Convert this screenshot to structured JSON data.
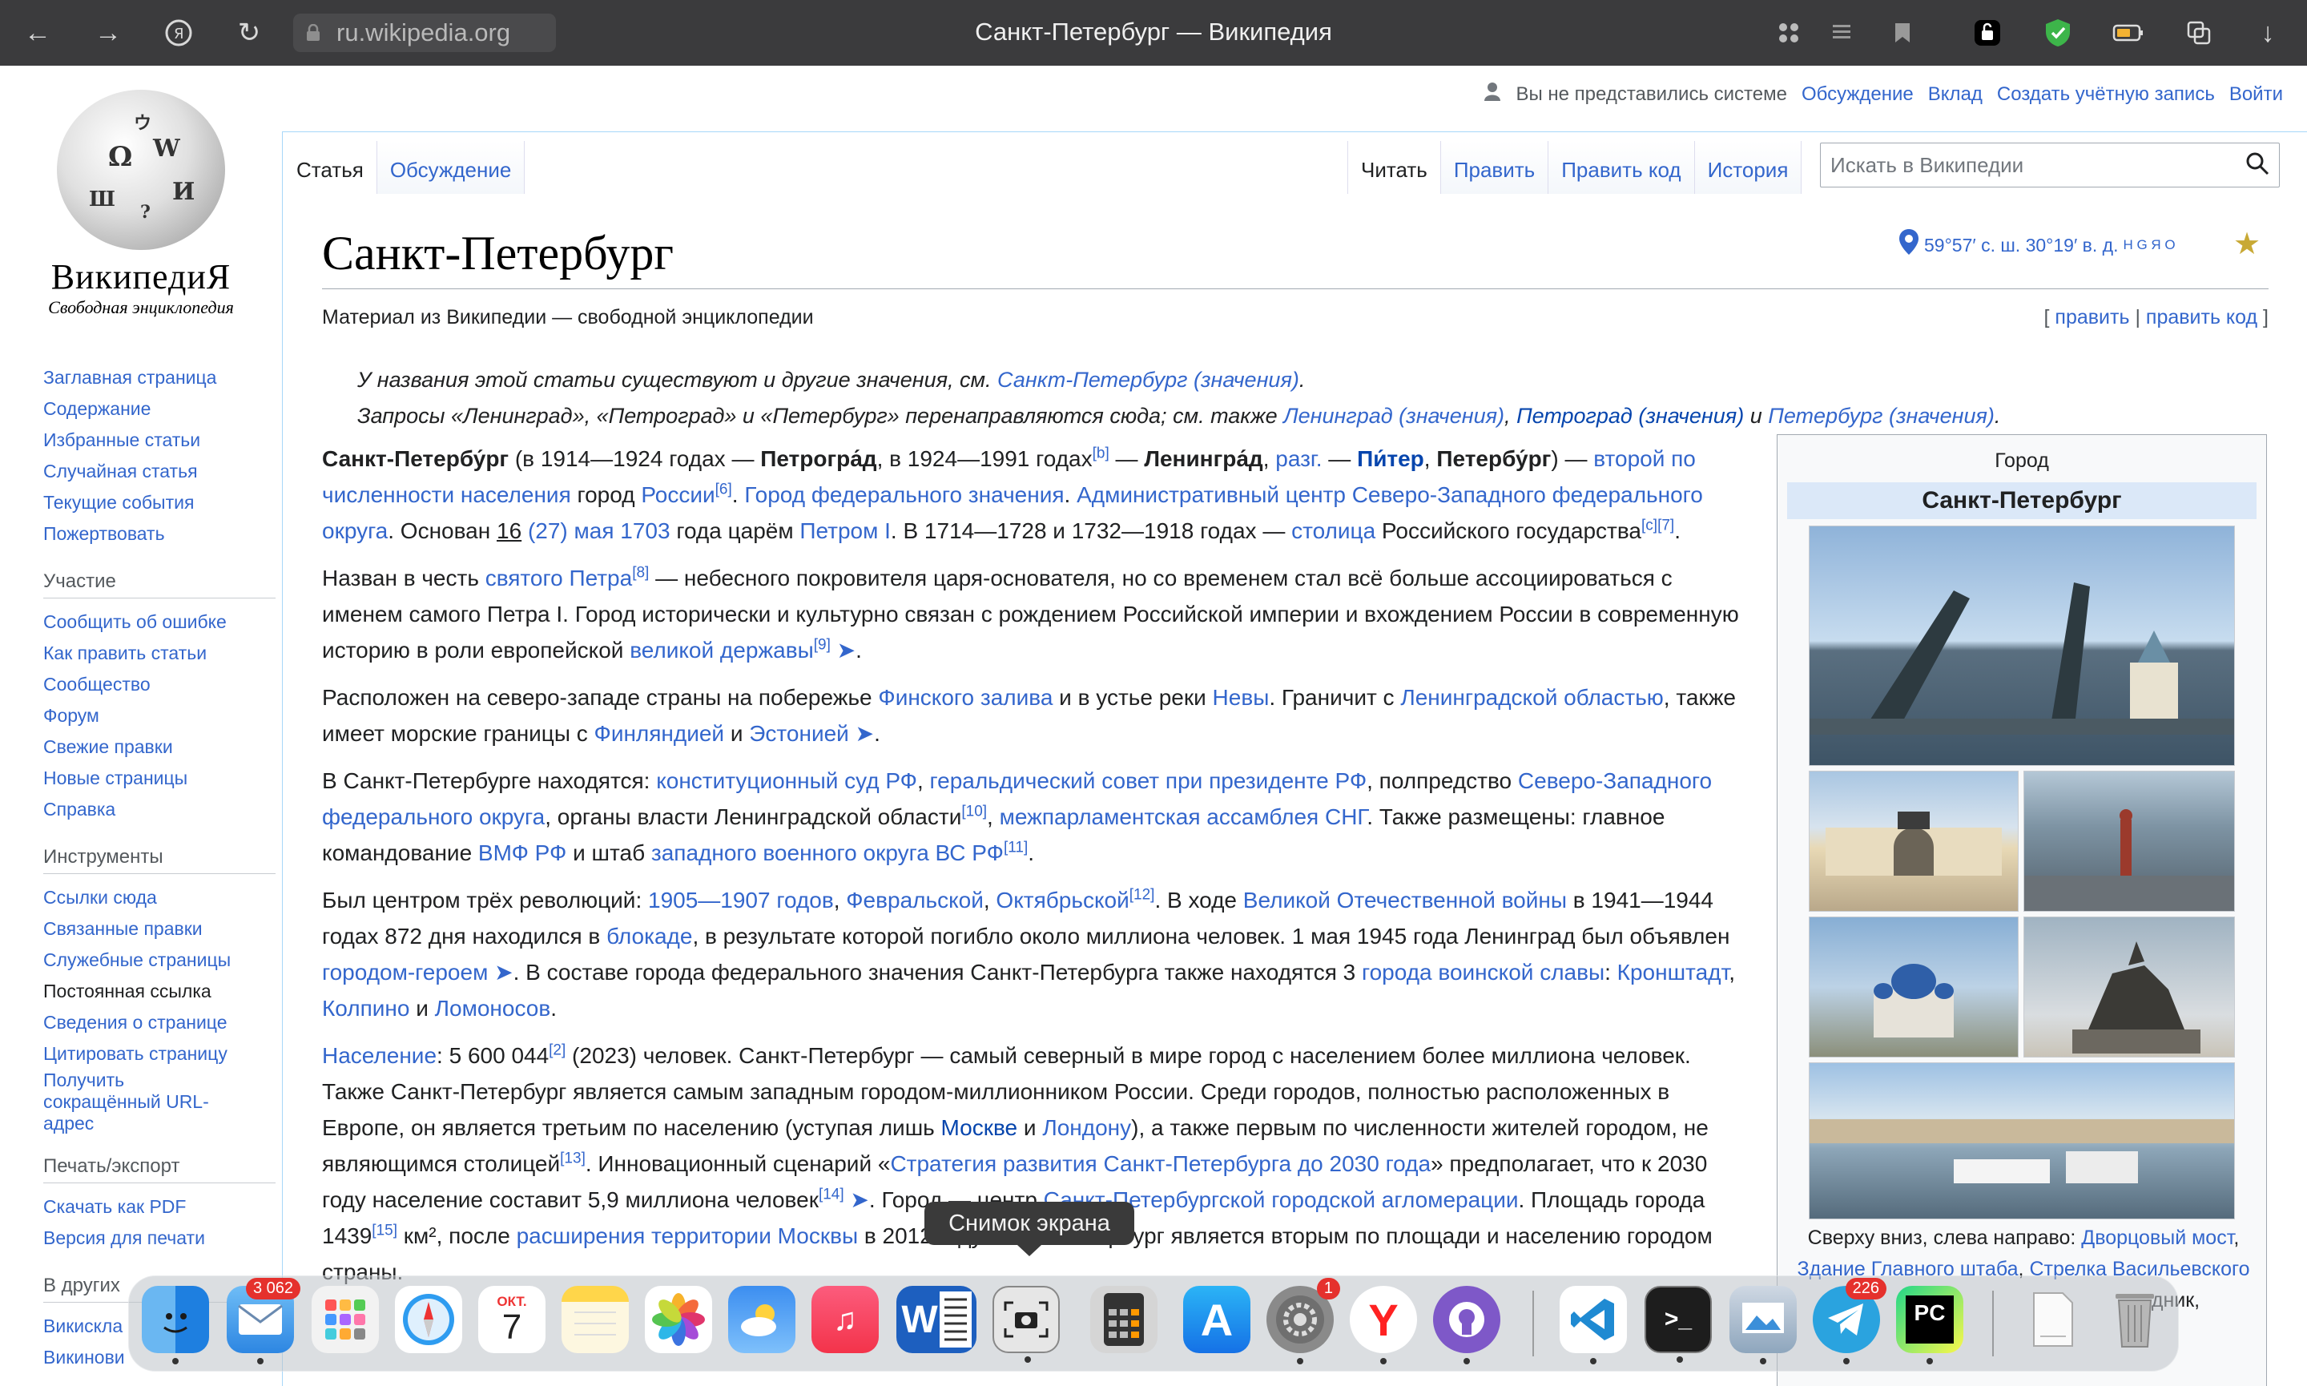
{
  "browser": {
    "url_host": "ru.wikipedia.org",
    "window_title": "Санкт-Петербург — Википедия"
  },
  "logo": {
    "wordmark": "ВикипедиЯ",
    "tagline": "Свободная энциклопедия"
  },
  "sidebar": {
    "nav": [
      "Заглавная страница",
      "Содержание",
      "Избранные статьи",
      "Случайная статья",
      "Текущие события",
      "Пожертвовать"
    ],
    "participation_heading": "Участие",
    "participation": [
      "Сообщить об ошибке",
      "Как править статьи",
      "Сообщество",
      "Форум",
      "Свежие правки",
      "Новые страницы",
      "Справка"
    ],
    "tools_heading": "Инструменты",
    "tools": [
      "Ссылки сюда",
      "Связанные правки",
      "Служебные страницы",
      "Постоянная ссылка",
      "Сведения о странице",
      "Цитировать страницу",
      "Получить",
      "сокращённый URL-",
      "адрес"
    ],
    "print_heading": "Печать/экспорт",
    "print": [
      "Скачать как PDF",
      "Версия для печати"
    ],
    "other_heading": "В других",
    "other": [
      "Викискла",
      "Викинови"
    ]
  },
  "userbar": {
    "anon": "Вы не представились системе",
    "talk": "Обсуждение",
    "contrib": "Вклад",
    "create": "Создать учётную запись",
    "login": "Войти"
  },
  "tabs": {
    "article": "Статья",
    "talk": "Обсуждение",
    "read": "Читать",
    "edit": "Править",
    "edit_source": "Править код",
    "history": "История"
  },
  "search": {
    "placeholder": "Искать в Википедии"
  },
  "title": "Санкт-Петербург",
  "coords": {
    "text": "59°57′ с. ш. 30°19′ в. д.",
    "links": "H G Я O"
  },
  "from_wiki": "Материал из Википедии — свободной энциклопедии",
  "edit_links": {
    "open": "[",
    "edit": "править",
    "sep": "|",
    "edit_source": "править код",
    "close": "]"
  },
  "hatnote": {
    "l1_a": "У названия этой статьи существуют и другие значения, см. ",
    "l1_link": "Санкт-Петербург (значения)",
    "l1_b": ".",
    "l2_a": "Запросы «Ленинград», «Петроград» и «Петербург» перенаправляются сюда; см. также ",
    "l2_link1": "Ленинград (значения)",
    "l2_comma": ", ",
    "l2_link2": "Петроград (значения)",
    "l2_and": " и ",
    "l2_link3": "Петербург (значения)",
    "l2_end": "."
  },
  "infobox": {
    "type": "Город",
    "name": "Санкт-Петербург",
    "caption_a": "Сверху вниз, слева направо: ",
    "caption_l1": "Дворцовый мост",
    "caption_c1": ", ",
    "caption_l2": "Здание Главного штаба",
    "caption_c2": ", ",
    "caption_l3": "Стрелка Васильевского",
    "caption_tail": "дник,"
  },
  "dock": {
    "mail_badge": "3 062",
    "calendar_month": "ОКТ.",
    "calendar_day": "7",
    "settings_badge": "1",
    "telegram_badge": "226",
    "tooltip": "Снимок экрана"
  },
  "colors": {
    "link": "#3366cc",
    "toolbar": "#3b3b3d",
    "infobox_title": "#dbe8f8"
  }
}
